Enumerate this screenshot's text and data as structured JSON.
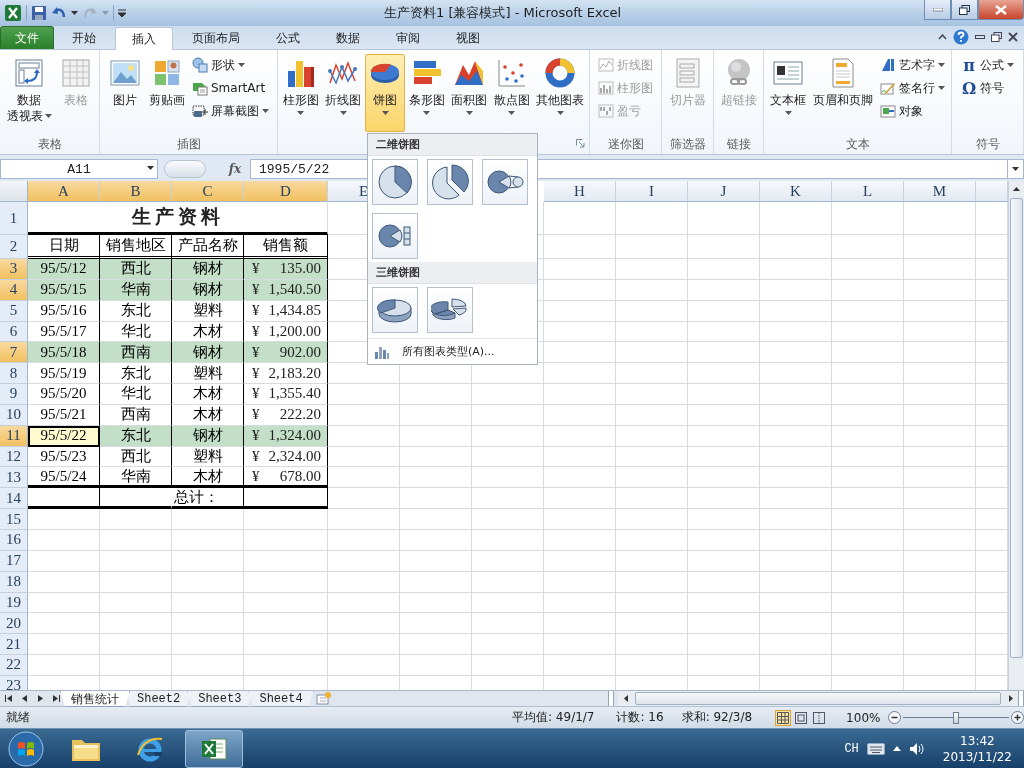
{
  "window": {
    "title": "生产资料1  [兼容模式]  -  Microsoft Excel"
  },
  "ribbon_tabs": [
    {
      "label": "文件",
      "kind": "file",
      "selected": false
    },
    {
      "label": "开始",
      "kind": "tab",
      "selected": false
    },
    {
      "label": "插入",
      "kind": "tab",
      "selected": true
    },
    {
      "label": "页面布局",
      "kind": "tab",
      "selected": false
    },
    {
      "label": "公式",
      "kind": "tab",
      "selected": false
    },
    {
      "label": "数据",
      "kind": "tab",
      "selected": false
    },
    {
      "label": "审阅",
      "kind": "tab",
      "selected": false
    },
    {
      "label": "视图",
      "kind": "tab",
      "selected": false
    }
  ],
  "ribbon_groups": [
    {
      "label": "表格",
      "items": [
        {
          "kind": "large",
          "label_lines": [
            "数据",
            "透视表"
          ],
          "caret": true,
          "disabled": false
        },
        {
          "kind": "large",
          "label": "表格",
          "disabled": true
        }
      ]
    },
    {
      "label": "插图",
      "items": [
        {
          "kind": "large",
          "label": "图片",
          "disabled": false
        },
        {
          "kind": "large",
          "label": "剪贴画",
          "disabled": false
        },
        {
          "kind": "small",
          "label": "形状",
          "caret": true,
          "disabled": false
        },
        {
          "kind": "small",
          "label": "SmartArt",
          "disabled": false
        },
        {
          "kind": "small",
          "label": "屏幕截图",
          "caret": true,
          "disabled": false
        }
      ]
    },
    {
      "launcher": true,
      "items": [
        {
          "kind": "large",
          "label": "柱形图",
          "caret": true,
          "pressed": false,
          "disabled": false
        },
        {
          "kind": "large",
          "label": "折线图",
          "caret": true,
          "pressed": false,
          "disabled": false
        },
        {
          "kind": "large",
          "label": "饼图",
          "caret": true,
          "pressed": true,
          "disabled": false
        },
        {
          "kind": "large",
          "label": "条形图",
          "caret": true,
          "pressed": false,
          "disabled": false
        },
        {
          "kind": "large",
          "label": "面积图",
          "caret": true,
          "pressed": false,
          "disabled": false
        },
        {
          "kind": "large",
          "label": "散点图",
          "caret": true,
          "pressed": false,
          "disabled": false
        },
        {
          "kind": "large",
          "label": "其他图表",
          "caret": true,
          "pressed": false,
          "disabled": false
        }
      ]
    },
    {
      "label": "迷你图",
      "items": [
        {
          "kind": "small",
          "label": "折线图",
          "disabled": true
        },
        {
          "kind": "small",
          "label": "柱形图",
          "disabled": true
        },
        {
          "kind": "small",
          "label": "盈亏",
          "disabled": true
        }
      ]
    },
    {
      "label": "筛选器",
      "items": [
        {
          "kind": "large",
          "label": "切片器",
          "disabled": true
        }
      ]
    },
    {
      "label": "链接",
      "items": [
        {
          "kind": "large",
          "label": "超链接",
          "disabled": true
        }
      ]
    },
    {
      "label": "文本",
      "items": [
        {
          "kind": "large",
          "label": "文本框",
          "caret": true,
          "disabled": false
        },
        {
          "kind": "large",
          "label": "页眉和页脚",
          "disabled": false
        },
        {
          "kind": "small",
          "label": "艺术字",
          "caret": true,
          "disabled": false
        },
        {
          "kind": "small",
          "label": "签名行",
          "caret": true,
          "disabled": false
        },
        {
          "kind": "small",
          "label": "对象",
          "disabled": false
        }
      ]
    },
    {
      "label": "符号",
      "items": [
        {
          "kind": "glyph",
          "glyph": "π",
          "label": "公式",
          "caret": true,
          "disabled": false
        },
        {
          "kind": "glyph",
          "glyph": "Ω",
          "label": "符号",
          "disabled": false
        }
      ]
    }
  ],
  "formula_bar": {
    "name_box": "A11",
    "function_label": "fx",
    "value": "1995/5/22"
  },
  "sheet": {
    "columns": [
      {
        "label": "A",
        "selected": true
      },
      {
        "label": "B",
        "selected": true
      },
      {
        "label": "C",
        "selected": true
      },
      {
        "label": "D",
        "selected": true
      },
      {
        "label": "E",
        "selected": false
      },
      {
        "label": "H",
        "selected": false
      },
      {
        "label": "I",
        "selected": false
      },
      {
        "label": "J",
        "selected": false
      },
      {
        "label": "K",
        "selected": false
      },
      {
        "label": "L",
        "selected": false
      },
      {
        "label": "M",
        "selected": false
      },
      {
        "selected": false
      }
    ],
    "rows": [
      {
        "header": "1",
        "kind": "title",
        "selected": false,
        "text": "生产资料"
      },
      {
        "header": "2",
        "kind": "header",
        "selected": false,
        "cells": [
          "日期",
          "销售地区",
          "产品名称",
          "销售额"
        ]
      },
      {
        "header": "3",
        "kind": "data",
        "selected": true,
        "active": false,
        "date": "95/5/12",
        "region": "西北",
        "product": "钢材",
        "currency": "¥",
        "amount": "135.00"
      },
      {
        "header": "4",
        "kind": "data",
        "selected": true,
        "active": false,
        "date": "95/5/15",
        "region": "华南",
        "product": "钢材",
        "currency": "¥",
        "amount": "1,540.50"
      },
      {
        "header": "5",
        "kind": "data",
        "selected": false,
        "active": false,
        "date": "95/5/16",
        "region": "东北",
        "product": "塑料",
        "currency": "¥",
        "amount": "1,434.85"
      },
      {
        "header": "6",
        "kind": "data",
        "selected": false,
        "active": false,
        "date": "95/5/17",
        "region": "华北",
        "product": "木材",
        "currency": "¥",
        "amount": "1,200.00"
      },
      {
        "header": "7",
        "kind": "data",
        "selected": true,
        "active": false,
        "date": "95/5/18",
        "region": "西南",
        "product": "钢材",
        "currency": "¥",
        "amount": "902.00"
      },
      {
        "header": "8",
        "kind": "data",
        "selected": false,
        "active": false,
        "date": "95/5/19",
        "region": "东北",
        "product": "塑料",
        "currency": "¥",
        "amount": "2,183.20"
      },
      {
        "header": "9",
        "kind": "data",
        "selected": false,
        "active": false,
        "date": "95/5/20",
        "region": "华北",
        "product": "木材",
        "currency": "¥",
        "amount": "1,355.40"
      },
      {
        "header": "10",
        "kind": "data",
        "selected": false,
        "active": false,
        "date": "95/5/21",
        "region": "西南",
        "product": "木材",
        "currency": "¥",
        "amount": "222.20"
      },
      {
        "header": "11",
        "kind": "data",
        "selected": true,
        "active": true,
        "date": "95/5/22",
        "region": "东北",
        "product": "钢材",
        "currency": "¥",
        "amount": "1,324.00"
      },
      {
        "header": "12",
        "kind": "data",
        "selected": false,
        "active": false,
        "date": "95/5/23",
        "region": "西北",
        "product": "塑料",
        "currency": "¥",
        "amount": "2,324.00"
      },
      {
        "header": "13",
        "kind": "data",
        "selected": false,
        "active": false,
        "date": "95/5/24",
        "region": "华南",
        "product": "木材",
        "currency": "¥",
        "amount": "678.00"
      },
      {
        "header": "14",
        "kind": "total",
        "selected": false,
        "text": "总计："
      },
      {
        "header": "15",
        "kind": "empty",
        "selected": false
      },
      {
        "header": "16",
        "kind": "empty",
        "selected": false
      },
      {
        "header": "17",
        "kind": "empty",
        "selected": false
      },
      {
        "header": "18",
        "kind": "empty",
        "selected": false
      },
      {
        "header": "19",
        "kind": "empty",
        "selected": false
      },
      {
        "header": "20",
        "kind": "empty",
        "selected": false
      },
      {
        "header": "21",
        "kind": "empty",
        "selected": false
      },
      {
        "header": "22",
        "kind": "empty",
        "selected": false
      },
      {
        "header": "23",
        "kind": "empty",
        "selected": false
      }
    ]
  },
  "chart_menu": {
    "sections": [
      {
        "title": "二维饼图",
        "options": [
          {
            "kind": "pie"
          },
          {
            "kind": "exploded-pie"
          },
          {
            "kind": "pie-of-pie"
          },
          {
            "kind": "bar-of-pie"
          }
        ]
      },
      {
        "title": "三维饼图",
        "options": [
          {
            "kind": "pie-3d"
          },
          {
            "kind": "exploded-pie-3d"
          }
        ]
      }
    ],
    "footer": "所有图表类型(A)..."
  },
  "sheet_tabs": [
    {
      "label": "销售统计",
      "selected": true
    },
    {
      "label": "Sheet2",
      "selected": false
    },
    {
      "label": "Sheet3",
      "selected": false
    },
    {
      "label": "Sheet4",
      "selected": false
    }
  ],
  "status_bar": {
    "mode": "就绪",
    "average": "平均值: 49/1/7",
    "count": "计数: 16",
    "sum": "求和: 92/3/8",
    "views": [
      {
        "selected": true
      },
      {
        "selected": false
      },
      {
        "selected": false
      }
    ],
    "zoom": "100%",
    "zoom_slider": {
      "level": 0.5
    }
  },
  "taskbar": {
    "apps": [
      {
        "active": false
      },
      {
        "active": false
      },
      {
        "active": true
      }
    ],
    "language": "CH",
    "time": "13:42",
    "date": "2013/11/22"
  }
}
